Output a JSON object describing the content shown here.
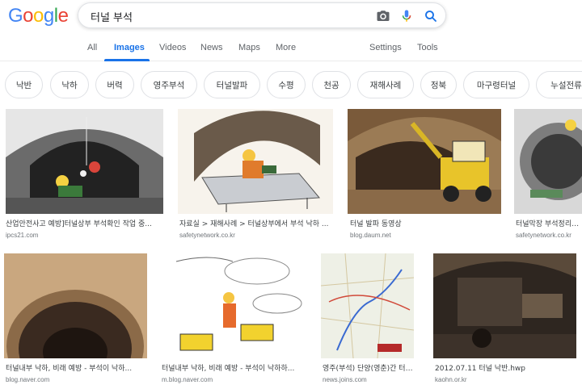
{
  "logo": {
    "text": "Google"
  },
  "search": {
    "query": "터널 부석",
    "camera_icon": "camera-icon",
    "mic_icon": "mic-icon",
    "search_icon": "search-icon"
  },
  "nav": {
    "tabs": [
      "All",
      "Images",
      "Videos",
      "News",
      "Maps",
      "More"
    ],
    "settings": "Settings",
    "tools": "Tools"
  },
  "chips": [
    "낙반",
    "낙하",
    "버력",
    "영주부석",
    "터널발파",
    "수평",
    "천공",
    "재해사례",
    "정북",
    "마구령터널",
    "누설전류"
  ],
  "results": [
    {
      "caption": "산업안전사고 예방]터널상부 부석확인 작업 중...",
      "source": "ipcs21.com"
    },
    {
      "caption": "자료실 > 재해사례 > 터널상부에서 부석 낙하 ...",
      "source": "safetynetwork.co.kr"
    },
    {
      "caption": "터널 발파 동영상",
      "source": "blog.daum.net"
    },
    {
      "caption": "터널막장 부석정리작...",
      "source": "safetynetwork.co.kr"
    },
    {
      "caption": "터널내부 낙하, 비래 예방 - 부석이 낙하...",
      "source": "blog.naver.com"
    },
    {
      "caption": "터널내부 낙하, 비래 예방 - 부석이 낙하하...",
      "source": "m.blog.naver.com"
    },
    {
      "caption": "영주(부석) 단양(영춘)간 터널 ...",
      "source": "news.joins.com"
    },
    {
      "caption": "2012.07.11 터널 낙반.hwp",
      "source": "kaohn.or.kr"
    }
  ],
  "colors": {
    "accent": "#1a73e8",
    "google_blue": "#4285f4",
    "google_red": "#ea4335",
    "google_yellow": "#fbbc05",
    "google_green": "#34a853"
  }
}
